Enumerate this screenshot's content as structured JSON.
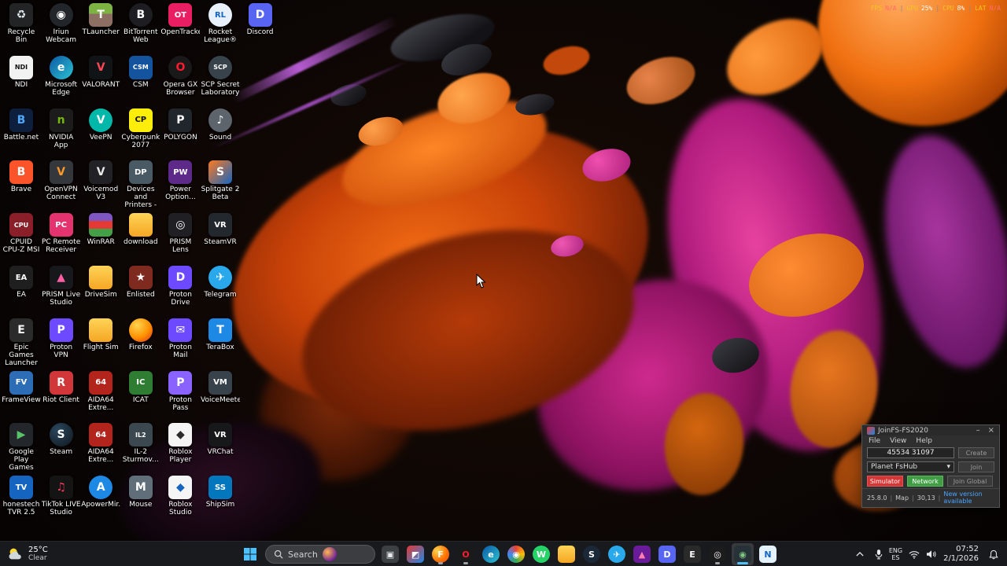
{
  "performance_overlay": {
    "separator": "|",
    "items": [
      {
        "label": "FPS",
        "value": "N/A"
      },
      {
        "label": "GPU",
        "value": "25%"
      },
      {
        "label": "CPU",
        "value": "8%"
      },
      {
        "label": "LAT",
        "value": "N/A"
      }
    ]
  },
  "desktop": {
    "icons": [
      {
        "label": "Recycle Bin",
        "col": 0,
        "row": 0,
        "glyph": "♻",
        "bg": "rgba(150,170,180,0.2)",
        "fg": "#dfe7ec"
      },
      {
        "label": "NDI",
        "col": 0,
        "row": 1,
        "glyph": "NDI",
        "bg": "#f2f2f2",
        "fg": "#111"
      },
      {
        "label": "Battle.net",
        "col": 0,
        "row": 2,
        "glyph": "B",
        "bg": "#0d1f3c",
        "fg": "#4fa8ff"
      },
      {
        "label": "Brave",
        "col": 0,
        "row": 3,
        "glyph": "B",
        "bg": "#fb542b"
      },
      {
        "label": "CPUID CPU-Z MSI",
        "col": 0,
        "row": 4,
        "glyph": "CPU",
        "bg": "#8a1f2a"
      },
      {
        "label": "EA",
        "col": 0,
        "row": 5,
        "glyph": "EA",
        "bg": "#1f1f1f"
      },
      {
        "label": "Epic Games Launcher",
        "col": 0,
        "row": 6,
        "glyph": "E",
        "bg": "#2b2b2b"
      },
      {
        "label": "FrameView",
        "col": 0,
        "row": 7,
        "glyph": "FV",
        "bg": "#2d6db5"
      },
      {
        "label": "Google Play Games",
        "col": 0,
        "row": 8,
        "glyph": "▶",
        "bg": "#23272b",
        "fg": "#58c16a"
      },
      {
        "label": "honestech TVR 2.5",
        "col": 0,
        "row": 9,
        "glyph": "TV",
        "bg": "#1565c0"
      },
      {
        "label": "Iriun Webcam",
        "col": 1,
        "row": 0,
        "glyph": "◉",
        "bg": "#22262a",
        "shape": "circle"
      },
      {
        "label": "Microsoft Edge",
        "col": 1,
        "row": 1,
        "glyph": "e",
        "bg": "linear-gradient(135deg,#0c59a4,#2bc3d2)",
        "shape": "circle"
      },
      {
        "label": "NVIDIA App",
        "col": 1,
        "row": 2,
        "glyph": "n",
        "bg": "#1c1c1c",
        "fg": "#76b900"
      },
      {
        "label": "OpenVPN Connect",
        "col": 1,
        "row": 3,
        "glyph": "V",
        "bg": "#34383c",
        "fg": "#ff9a2a"
      },
      {
        "label": "PC Remote Receiver",
        "col": 1,
        "row": 4,
        "glyph": "PC",
        "bg": "#e4336e"
      },
      {
        "label": "PRISM Live Studio",
        "col": 1,
        "row": 5,
        "glyph": "▲",
        "bg": "#17181c",
        "fg": "#ff5fa2"
      },
      {
        "label": "Proton VPN",
        "col": 1,
        "row": 6,
        "glyph": "P",
        "bg": "#6d4aff"
      },
      {
        "label": "Riot Client",
        "col": 1,
        "row": 7,
        "glyph": "R",
        "bg": "#d13639"
      },
      {
        "label": "Steam",
        "col": 1,
        "row": 8,
        "glyph": "S",
        "bg": "radial-gradient(circle at 35% 30%,#2a475e,#10161d)",
        "shape": "circle"
      },
      {
        "label": "TikTok LIVE Studio",
        "col": 1,
        "row": 9,
        "glyph": "♫",
        "bg": "#141414",
        "fg": "#ff3b5c"
      },
      {
        "label": "TLauncher",
        "col": 2,
        "row": 0,
        "glyph": "T",
        "bg": "linear-gradient(#7cb342 45%,#8d6e63 45%)"
      },
      {
        "label": "VALORANT",
        "col": 2,
        "row": 1,
        "glyph": "V",
        "bg": "#101417",
        "fg": "#ff4655"
      },
      {
        "label": "VeePN",
        "col": 2,
        "row": 2,
        "glyph": "V",
        "bg": "#00b8a9",
        "shape": "circle"
      },
      {
        "label": "Voicemod V3",
        "col": 2,
        "row": 3,
        "glyph": "V",
        "bg": "#212126",
        "fg": "#e8e8e8"
      },
      {
        "label": "WinRAR",
        "col": 2,
        "row": 4,
        "glyph": "",
        "bg": "linear-gradient(#7e57c2 33%,#e53935 33% 66%,#43a047 66%)"
      },
      {
        "label": "DriveSim",
        "col": 2,
        "row": 5,
        "glyph": "",
        "bg": "linear-gradient(#ffd457,#f5a623)"
      },
      {
        "label": "Flight Sim",
        "col": 2,
        "row": 6,
        "glyph": "",
        "bg": "linear-gradient(#ffd457,#f5a623)"
      },
      {
        "label": "AIDA64 Extre...",
        "col": 2,
        "row": 7,
        "glyph": "64",
        "bg": "#b3241c"
      },
      {
        "label": "AIDA64 Extre...",
        "col": 2,
        "row": 8,
        "glyph": "64",
        "bg": "#b3241c"
      },
      {
        "label": "ApowerMir...",
        "col": 2,
        "row": 9,
        "glyph": "A",
        "bg": "#1e88e5",
        "shape": "circle"
      },
      {
        "label": "BitTorrent Web",
        "col": 3,
        "row": 0,
        "glyph": "B",
        "bg": "#1d1d22",
        "shape": "circle"
      },
      {
        "label": "CSM",
        "col": 3,
        "row": 1,
        "glyph": "CSM",
        "bg": "#14539e"
      },
      {
        "label": "Cyberpunk 2077",
        "col": 3,
        "row": 2,
        "glyph": "CP",
        "bg": "#fcee0a",
        "fg": "#101010"
      },
      {
        "label": "Devices and Printers - ...",
        "col": 3,
        "row": 3,
        "glyph": "DP",
        "bg": "#4a5a64"
      },
      {
        "label": "download",
        "col": 3,
        "row": 4,
        "glyph": "",
        "bg": "linear-gradient(#ffd457,#f5a623)"
      },
      {
        "label": "Enlisted",
        "col": 3,
        "row": 5,
        "glyph": "★",
        "bg": "#7e2a1e"
      },
      {
        "label": "Firefox",
        "col": 3,
        "row": 6,
        "glyph": "",
        "bg": "radial-gradient(circle at 35% 30%,#ffd54f,#ff8f00 55%,#e64a19 85%)",
        "shape": "circle"
      },
      {
        "label": "ICAT",
        "col": 3,
        "row": 7,
        "glyph": "IC",
        "bg": "#2e7d32"
      },
      {
        "label": "IL-2 Sturmov...",
        "col": 3,
        "row": 8,
        "glyph": "IL2",
        "bg": "#3c4850"
      },
      {
        "label": "Mouse",
        "col": 3,
        "row": 9,
        "glyph": "M",
        "bg": "#5f6e78"
      },
      {
        "label": "OpenTracker",
        "col": 4,
        "row": 0,
        "glyph": "OT",
        "bg": "#e91e63"
      },
      {
        "label": "Opera GX Browser",
        "col": 4,
        "row": 1,
        "glyph": "O",
        "bg": "#191919",
        "fg": "#ff1b2d",
        "shape": "circle"
      },
      {
        "label": "POLYGON",
        "col": 4,
        "row": 2,
        "glyph": "P",
        "bg": "#20262c"
      },
      {
        "label": "Power Option...",
        "col": 4,
        "row": 3,
        "glyph": "PW",
        "bg": "#5e2a8a"
      },
      {
        "label": "PRISM Lens",
        "col": 4,
        "row": 4,
        "glyph": "◎",
        "bg": "#202024"
      },
      {
        "label": "Proton Drive",
        "col": 4,
        "row": 5,
        "glyph": "D",
        "bg": "#6d4aff"
      },
      {
        "label": "Proton Mail",
        "col": 4,
        "row": 6,
        "glyph": "✉",
        "bg": "#6d4aff"
      },
      {
        "label": "Proton Pass",
        "col": 4,
        "row": 7,
        "glyph": "P",
        "bg": "#8a63ff"
      },
      {
        "label": "Roblox Player",
        "col": 4,
        "row": 8,
        "glyph": "◆",
        "bg": "#f5f5f5",
        "fg": "#2b2b2b"
      },
      {
        "label": "Roblox Studio",
        "col": 4,
        "row": 9,
        "glyph": "◆",
        "bg": "#f5f5f5",
        "fg": "#1565c0"
      },
      {
        "label": "Rocket League®",
        "col": 5,
        "row": 0,
        "glyph": "RL",
        "bg": "#e8f1fb",
        "fg": "#1565c0",
        "shape": "circle"
      },
      {
        "label": "SCP Secret Laboratory",
        "col": 5,
        "row": 1,
        "glyph": "SCP",
        "bg": "#37424a",
        "shape": "circle"
      },
      {
        "label": "Sound",
        "col": 5,
        "row": 2,
        "glyph": "♪",
        "bg": "#5d646b",
        "shape": "circle"
      },
      {
        "label": "Splitgate 2 Beta",
        "col": 5,
        "row": 3,
        "glyph": "S",
        "bg": "linear-gradient(135deg,#ff7a1f,#1565c0)"
      },
      {
        "label": "SteamVR",
        "col": 5,
        "row": 4,
        "glyph": "VR",
        "bg": "#23282e"
      },
      {
        "label": "Telegram",
        "col": 5,
        "row": 5,
        "glyph": "✈",
        "bg": "#29a9eb",
        "shape": "circle"
      },
      {
        "label": "TeraBox",
        "col": 5,
        "row": 6,
        "glyph": "T",
        "bg": "#1e88e5"
      },
      {
        "label": "VoiceMeeter",
        "col": 5,
        "row": 7,
        "glyph": "VM",
        "bg": "#37424a"
      },
      {
        "label": "VRChat",
        "col": 5,
        "row": 8,
        "glyph": "VR",
        "bg": "#17181a"
      },
      {
        "label": "ShipSim",
        "col": 5,
        "row": 9,
        "glyph": "SS",
        "bg": "#0277bd"
      },
      {
        "label": "Discord",
        "col": 6,
        "row": 0,
        "glyph": "D",
        "bg": "#5865f2"
      }
    ]
  },
  "joinfs": {
    "title": "JoinFS-FS2020",
    "minimize": "–",
    "close": "×",
    "menu": [
      "File",
      "View",
      "Help"
    ],
    "code": "45534 31097",
    "create": "Create",
    "server": "Planet FsHub",
    "select_arrow": "▾",
    "join": "Join",
    "simulator": "Simulator",
    "network": "Network",
    "join_global": "Join Global",
    "sep": "|",
    "status_version": "25.8.0",
    "status_map": "Map",
    "status_coords": "30,13",
    "status_update": "New version available",
    "colors": {
      "simulator": "#d43535",
      "network": "#3f9e44",
      "update_link": "#4aa3ff"
    }
  },
  "taskbar": {
    "weather": {
      "temp": "25°C",
      "condition": "Clear"
    },
    "search_placeholder": "Search",
    "icons": [
      {
        "name": "task-view",
        "glyph": "▣",
        "bg": "#3d4043",
        "fg": "#e8eaed"
      },
      {
        "name": "photos",
        "glyph": "◩",
        "bg": "linear-gradient(135deg,#e53935,#1e88e5)"
      },
      {
        "name": "firefox",
        "glyph": "F",
        "bg": "radial-gradient(circle at 30% 30%,#ffd54f,#ff6f00 60%,#e64a19)",
        "shape": "circle",
        "running": true
      },
      {
        "name": "opera-gx",
        "glyph": "O",
        "bg": "#1a1a1a",
        "fg": "#ff1b2d",
        "shape": "circle",
        "running": true
      },
      {
        "name": "edge",
        "glyph": "e",
        "bg": "linear-gradient(135deg,#0c59a4,#2bc3d2)",
        "shape": "circle"
      },
      {
        "name": "chrome",
        "glyph": "◉",
        "bg": "conic-gradient(#ea4335,#fbbc05,#34a853,#4285f4,#ea4335)",
        "shape": "circle"
      },
      {
        "name": "whatsapp",
        "glyph": "W",
        "bg": "#25d366",
        "shape": "circle"
      },
      {
        "name": "file-explorer",
        "glyph": "",
        "bg": "linear-gradient(#ffd457,#f5a623)"
      },
      {
        "name": "steam",
        "glyph": "S",
        "bg": "#1b2838",
        "shape": "circle"
      },
      {
        "name": "telegram",
        "glyph": "✈",
        "bg": "#29a9eb",
        "shape": "circle"
      },
      {
        "name": "prism-live",
        "glyph": "▲",
        "bg": "#6a1b9a",
        "fg": "#ff80ab"
      },
      {
        "name": "discord",
        "glyph": "D",
        "bg": "#5865f2"
      },
      {
        "name": "epic-games",
        "glyph": "E",
        "bg": "#2a2a2a"
      },
      {
        "name": "obs-studio",
        "glyph": "◎",
        "bg": "#1c1c1c",
        "shape": "circle",
        "running": true
      },
      {
        "name": "camera-app",
        "glyph": "◉",
        "bg": "#263238",
        "fg": "#81c784",
        "active": true,
        "running": true
      },
      {
        "name": "notepad",
        "glyph": "N",
        "bg": "#e3f2fd",
        "fg": "#1565c0"
      }
    ],
    "tray": {
      "lang_top": "ENG",
      "lang_bottom": "ES",
      "time": "07:52",
      "date": "2/1/2026"
    }
  }
}
